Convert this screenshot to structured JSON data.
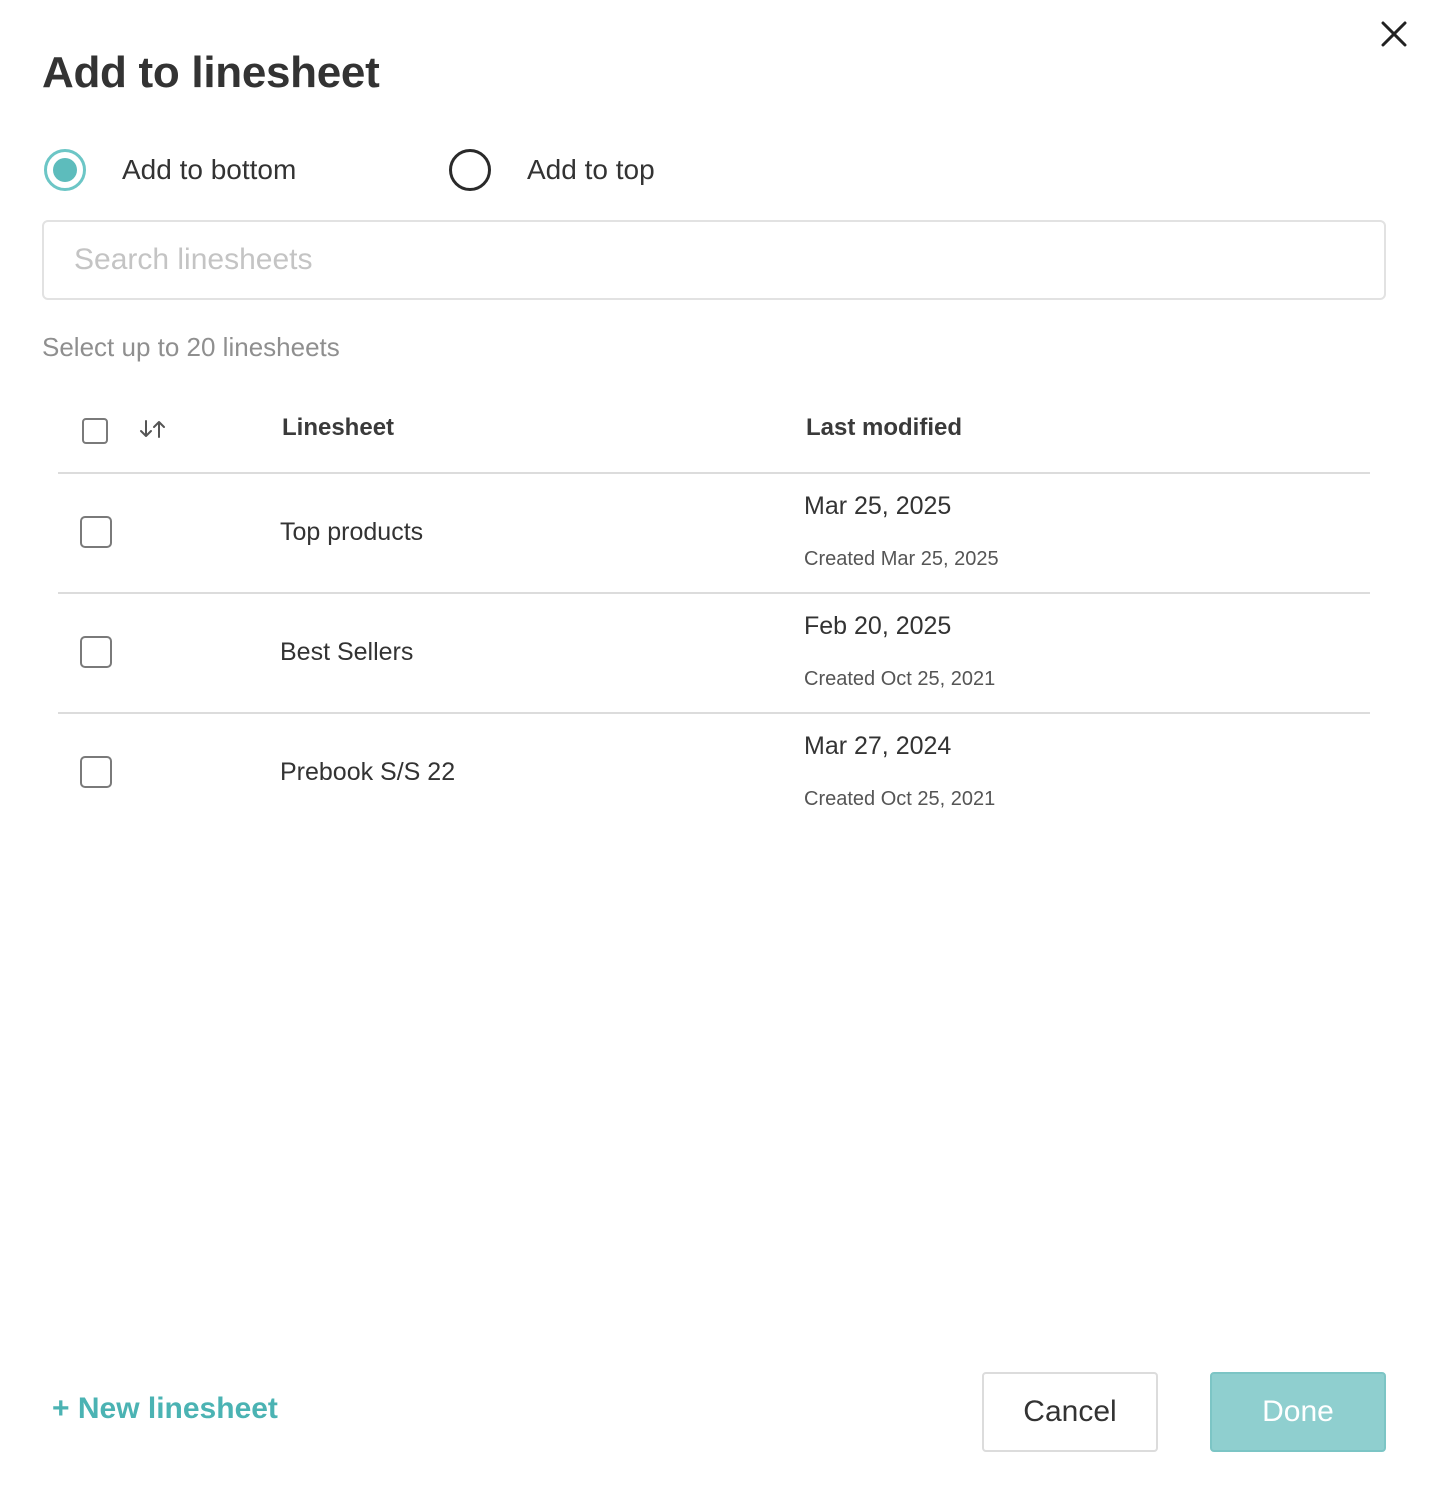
{
  "dialog": {
    "title": "Add to linesheet",
    "close_icon": "close-icon"
  },
  "position_options": [
    {
      "label": "Add to bottom",
      "selected": true
    },
    {
      "label": "Add to top",
      "selected": false
    }
  ],
  "search": {
    "placeholder": "Search linesheets",
    "value": ""
  },
  "hint": "Select up to 20 linesheets",
  "table": {
    "sort_icon": "sort-arrows-icon",
    "columns": [
      "Linesheet",
      "Last modified"
    ],
    "rows": [
      {
        "name": "Top products",
        "last_modified": "Mar 25, 2025",
        "created": "Created Mar 25, 2025",
        "checked": false
      },
      {
        "name": "Best Sellers",
        "last_modified": "Feb 20, 2025",
        "created": "Created Oct 25, 2021",
        "checked": false
      },
      {
        "name": "Prebook S/S 22",
        "last_modified": "Mar 27, 2024",
        "created": "Created Oct 25, 2021",
        "checked": false
      }
    ]
  },
  "footer": {
    "new_linesheet": "+ New linesheet",
    "cancel": "Cancel",
    "done": "Done"
  },
  "colors": {
    "accent": "#5dbcbc",
    "link": "#4bb3b3",
    "done_button_bg": "#8fcfcf",
    "text": "#333333",
    "muted_text": "#8f8f8f"
  }
}
